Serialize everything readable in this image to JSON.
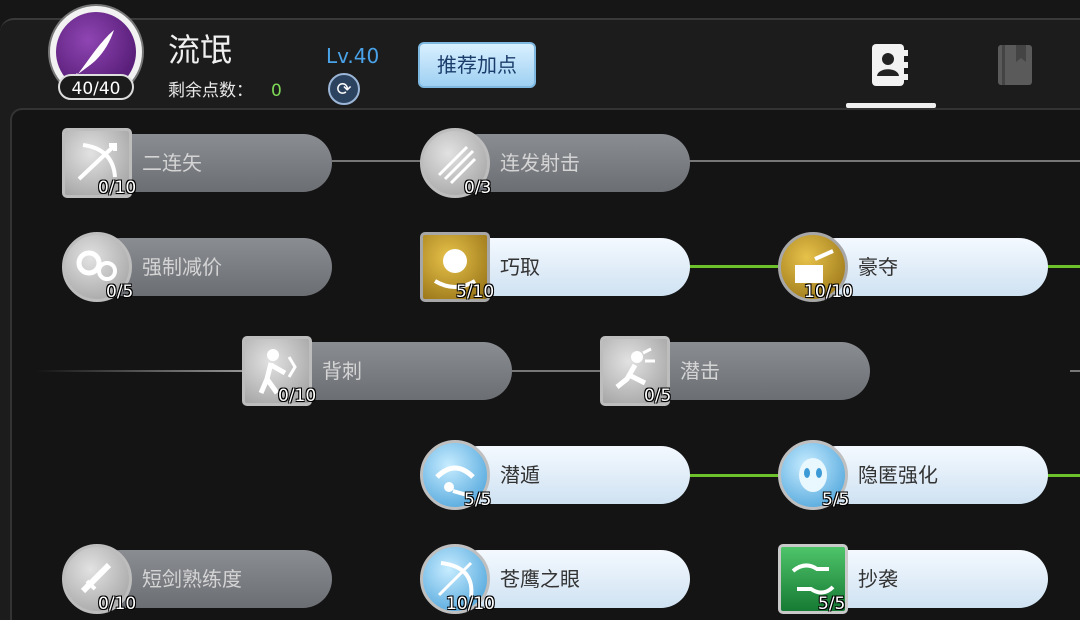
{
  "header": {
    "class_name": "流氓",
    "badge_points": "40/40",
    "remaining_label": "剩余点数：",
    "remaining_value": "0",
    "level": "Lv.40",
    "recommend_label": "推荐加点",
    "tabs": [
      {
        "icon": "contacts-icon",
        "active": true
      },
      {
        "icon": "book-icon",
        "active": false
      }
    ]
  },
  "skills": [
    {
      "name": "二连矢",
      "level": "0/10",
      "icon": "crossbow-icon",
      "style": "gray",
      "shape": "square",
      "active": false
    },
    {
      "name": "连发射击",
      "level": "0/3",
      "icon": "rapid-fire-icon",
      "style": "gray",
      "shape": "round",
      "active": false
    },
    {
      "name": "强制减价",
      "level": "0/5",
      "icon": "discount-icon",
      "style": "gray",
      "shape": "round",
      "active": false
    },
    {
      "name": "巧取",
      "level": "5/10",
      "icon": "steal-orb-icon",
      "style": "gold",
      "shape": "square",
      "active": true
    },
    {
      "name": "豪夺",
      "level": "10/10",
      "icon": "plunder-icon",
      "style": "gold",
      "shape": "round",
      "active": true
    },
    {
      "name": "背刺",
      "level": "0/10",
      "icon": "backstab-icon",
      "style": "gray",
      "shape": "square",
      "active": false
    },
    {
      "name": "潜击",
      "level": "0/5",
      "icon": "stealth-strike-icon",
      "style": "gray",
      "shape": "square",
      "active": false
    },
    {
      "name": "潜遁",
      "level": "5/5",
      "icon": "stealth-icon",
      "style": "blue",
      "shape": "round",
      "active": true
    },
    {
      "name": "隐匿强化",
      "level": "5/5",
      "icon": "hidden-mask-icon",
      "style": "blue",
      "shape": "round",
      "active": true
    },
    {
      "name": "短剑熟练度",
      "level": "0/10",
      "icon": "dagger-icon",
      "style": "gray",
      "shape": "round",
      "active": false
    },
    {
      "name": "苍鹰之眼",
      "level": "10/10",
      "icon": "hawk-eye-icon",
      "style": "blue",
      "shape": "round",
      "active": true
    },
    {
      "name": "抄袭",
      "level": "5/5",
      "icon": "copy-hands-icon",
      "style": "green",
      "shape": "square",
      "active": true
    }
  ]
}
